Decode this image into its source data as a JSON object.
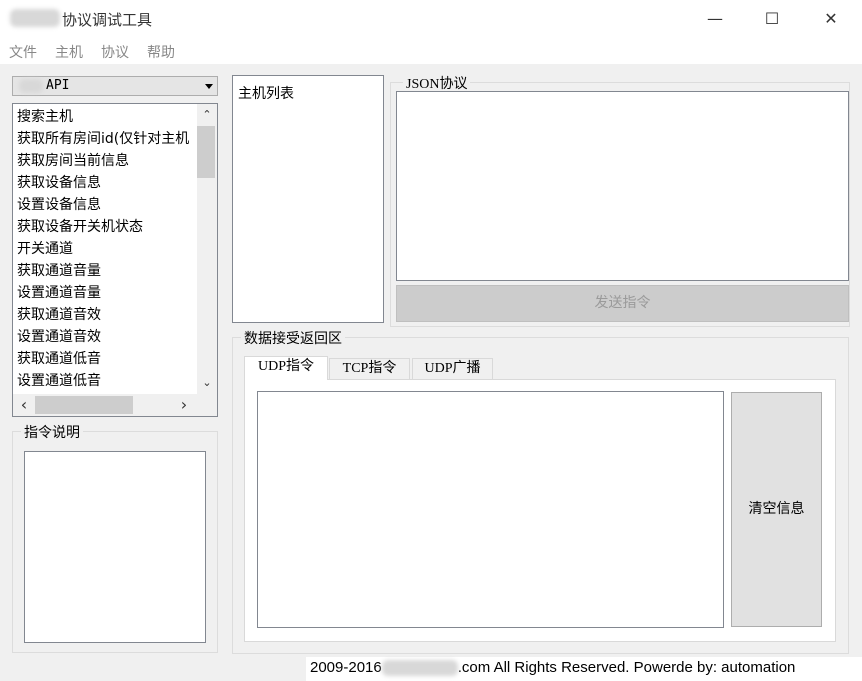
{
  "window": {
    "title": "协议调试工具",
    "controls": {
      "minimize": "—",
      "maximize": "☐",
      "close": "✕"
    }
  },
  "menu": [
    "文件",
    "主机",
    "协议",
    "帮助"
  ],
  "api_select": {
    "value": "API"
  },
  "command_list": [
    "搜索主机",
    "获取所有房间id(仅针对主机",
    "获取房间当前信息",
    "获取设备信息",
    "设置设备信息",
    "获取设备开关机状态",
    "开关通道",
    "获取通道音量",
    "设置通道音量",
    "获取通道音效",
    "设置通道音效",
    "获取通道低音",
    "设置通道低音"
  ],
  "scroll_arrows": {
    "up": "⌃",
    "down": "⌄",
    "left": "‹",
    "right": "›"
  },
  "command_desc": {
    "label": "指令说明"
  },
  "host_list": {
    "label": "主机列表"
  },
  "json_panel": {
    "label": "JSON协议",
    "send_button": "发送指令"
  },
  "receive_panel": {
    "label": "数据接受返回区",
    "tabs": [
      "UDP指令",
      "TCP指令",
      "UDP广播"
    ],
    "active_tab": 0,
    "clear_button": "清空信息"
  },
  "footer": {
    "year": "2009-2016",
    "rest": ".com All Rights Reserved. Powerde by:  automation"
  }
}
